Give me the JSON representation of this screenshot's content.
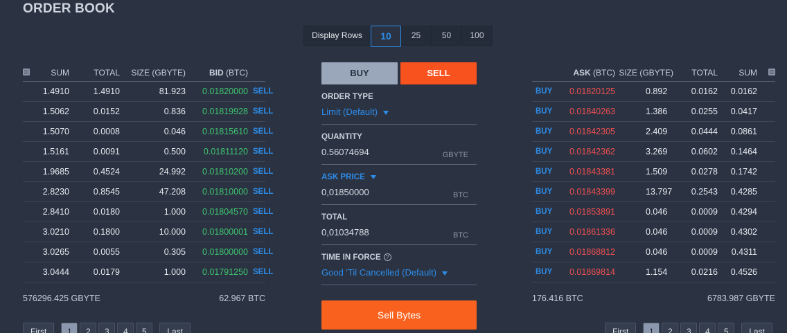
{
  "page_title": "ORDER BOOK",
  "display_rows": {
    "label": "Display Rows",
    "options": [
      "10",
      "25",
      "50",
      "100"
    ],
    "selected": "10"
  },
  "bids": {
    "headers": {
      "sum": "SUM",
      "total": "TOTAL",
      "size": "SIZE (GBYTE)",
      "bid": "BID",
      "bid_unit": "(BTC)"
    },
    "rows": [
      {
        "sum": "1.4910",
        "total": "1.4910",
        "size": "81.923",
        "price": "0.01820000",
        "action": "SELL"
      },
      {
        "sum": "1.5062",
        "total": "0.0152",
        "size": "0.836",
        "price": "0.01819928",
        "action": "SELL"
      },
      {
        "sum": "1.5070",
        "total": "0.0008",
        "size": "0.046",
        "price": "0.01815610",
        "action": "SELL"
      },
      {
        "sum": "1.5161",
        "total": "0.0091",
        "size": "0.500",
        "price": "0.01811120",
        "action": "SELL"
      },
      {
        "sum": "1.9685",
        "total": "0.4524",
        "size": "24.992",
        "price": "0.01810200",
        "action": "SELL"
      },
      {
        "sum": "2.8230",
        "total": "0.8545",
        "size": "47.208",
        "price": "0.01810000",
        "action": "SELL"
      },
      {
        "sum": "2.8410",
        "total": "0.0180",
        "size": "1.000",
        "price": "0.01804570",
        "action": "SELL"
      },
      {
        "sum": "3.0210",
        "total": "0.1800",
        "size": "10.000",
        "price": "0.01800001",
        "action": "SELL"
      },
      {
        "sum": "3.0265",
        "total": "0.0055",
        "size": "0.305",
        "price": "0.01800000",
        "action": "SELL"
      },
      {
        "sum": "3.0444",
        "total": "0.0179",
        "size": "1.000",
        "price": "0.01791250",
        "action": "SELL"
      }
    ],
    "footer_left": "576296.425 GBYTE",
    "footer_right": "62.967 BTC"
  },
  "asks": {
    "headers": {
      "ask": "ASK",
      "ask_unit": "(BTC)",
      "size": "SIZE (GBYTE)",
      "total": "TOTAL",
      "sum": "SUM"
    },
    "rows": [
      {
        "action": "BUY",
        "price": "0.01820125",
        "size": "0.892",
        "total": "0.0162",
        "sum": "0.0162"
      },
      {
        "action": "BUY",
        "price": "0.01840263",
        "size": "1.386",
        "total": "0.0255",
        "sum": "0.0417"
      },
      {
        "action": "BUY",
        "price": "0.01842305",
        "size": "2.409",
        "total": "0.0444",
        "sum": "0.0861"
      },
      {
        "action": "BUY",
        "price": "0.01842362",
        "size": "3.269",
        "total": "0.0602",
        "sum": "0.1464"
      },
      {
        "action": "BUY",
        "price": "0.01843381",
        "size": "1.509",
        "total": "0.0278",
        "sum": "0.1742"
      },
      {
        "action": "BUY",
        "price": "0.01843399",
        "size": "13.797",
        "total": "0.2543",
        "sum": "0.4285"
      },
      {
        "action": "BUY",
        "price": "0.01853891",
        "size": "0.046",
        "total": "0.0009",
        "sum": "0.4294"
      },
      {
        "action": "BUY",
        "price": "0.01861336",
        "size": "0.046",
        "total": "0.0009",
        "sum": "0.4302"
      },
      {
        "action": "BUY",
        "price": "0.01868812",
        "size": "0.046",
        "total": "0.0009",
        "sum": "0.4311"
      },
      {
        "action": "BUY",
        "price": "0.01869814",
        "size": "1.154",
        "total": "0.0216",
        "sum": "0.4526"
      }
    ],
    "footer_left": "176.416 BTC",
    "footer_right": "6783.987 GBYTE"
  },
  "order_form": {
    "buy_tab": "BUY",
    "sell_tab": "SELL",
    "active_tab": "SELL",
    "order_type_label": "ORDER TYPE",
    "order_type_value": "Limit (Default)",
    "quantity_label": "QUANTITY",
    "quantity_value": "0.56074694",
    "quantity_unit": "GBYTE",
    "ask_price_label": "ASK PRICE",
    "ask_price_value": "0,01850000",
    "ask_price_unit": "BTC",
    "total_label": "TOTAL",
    "total_value": "0,01034788",
    "total_unit": "BTC",
    "tif_label": "TIME IN FORCE",
    "tif_value": "Good 'Til Cancelled (Default)",
    "help_glyph": "?",
    "submit_label": "Sell Bytes"
  },
  "pagination": {
    "first": "First",
    "last": "Last",
    "pages": [
      "1",
      "2",
      "3",
      "4",
      "5"
    ],
    "current": "1"
  },
  "colors": {
    "background": "#2b3343",
    "bid_price": "#3ec46d",
    "ask_price": "#f04e4e",
    "accent_blue": "#2d8ce8",
    "sell_orange": "#f8521e"
  },
  "icons": {
    "table_menu": "list-icon",
    "dropdown": "caret-down-icon",
    "help": "question-circle-icon"
  }
}
